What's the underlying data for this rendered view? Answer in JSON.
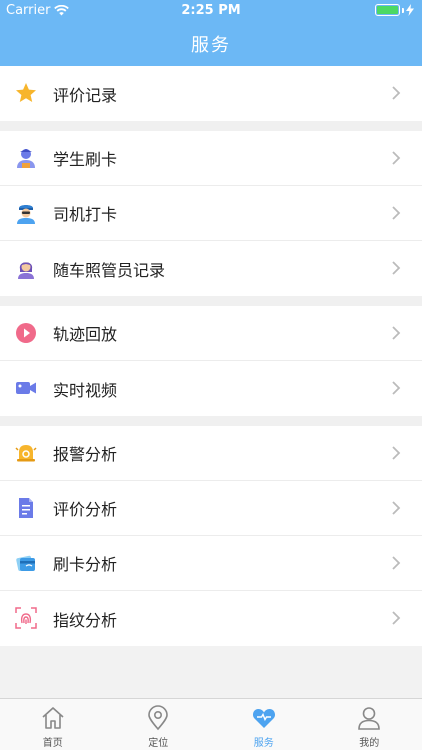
{
  "status_bar": {
    "carrier": "Carrier",
    "time": "2:25 PM"
  },
  "header": {
    "title": "服务"
  },
  "groups": [
    {
      "items": [
        {
          "label": "评价记录",
          "icon": "star-icon"
        }
      ]
    },
    {
      "items": [
        {
          "label": "学生刷卡",
          "icon": "student-icon"
        },
        {
          "label": "司机打卡",
          "icon": "driver-icon"
        },
        {
          "label": "随车照管员记录",
          "icon": "attendant-icon"
        }
      ]
    },
    {
      "items": [
        {
          "label": "轨迹回放",
          "icon": "play-icon"
        },
        {
          "label": "实时视频",
          "icon": "video-camera-icon"
        }
      ]
    },
    {
      "items": [
        {
          "label": "报警分析",
          "icon": "alarm-bell-icon"
        },
        {
          "label": "评价分析",
          "icon": "document-edit-icon"
        },
        {
          "label": "刷卡分析",
          "icon": "card-swipe-icon"
        },
        {
          "label": "指纹分析",
          "icon": "fingerprint-icon"
        }
      ]
    }
  ],
  "tabbar": {
    "items": [
      {
        "label": "首页",
        "icon": "home-icon"
      },
      {
        "label": "定位",
        "icon": "location-pin-icon"
      },
      {
        "label": "服务",
        "icon": "heart-icon",
        "active": true
      },
      {
        "label": "我的",
        "icon": "profile-icon"
      }
    ]
  },
  "colors": {
    "header": "#6cb8f5",
    "active_tab": "#4da3f0",
    "background": "#f2f2f2"
  }
}
